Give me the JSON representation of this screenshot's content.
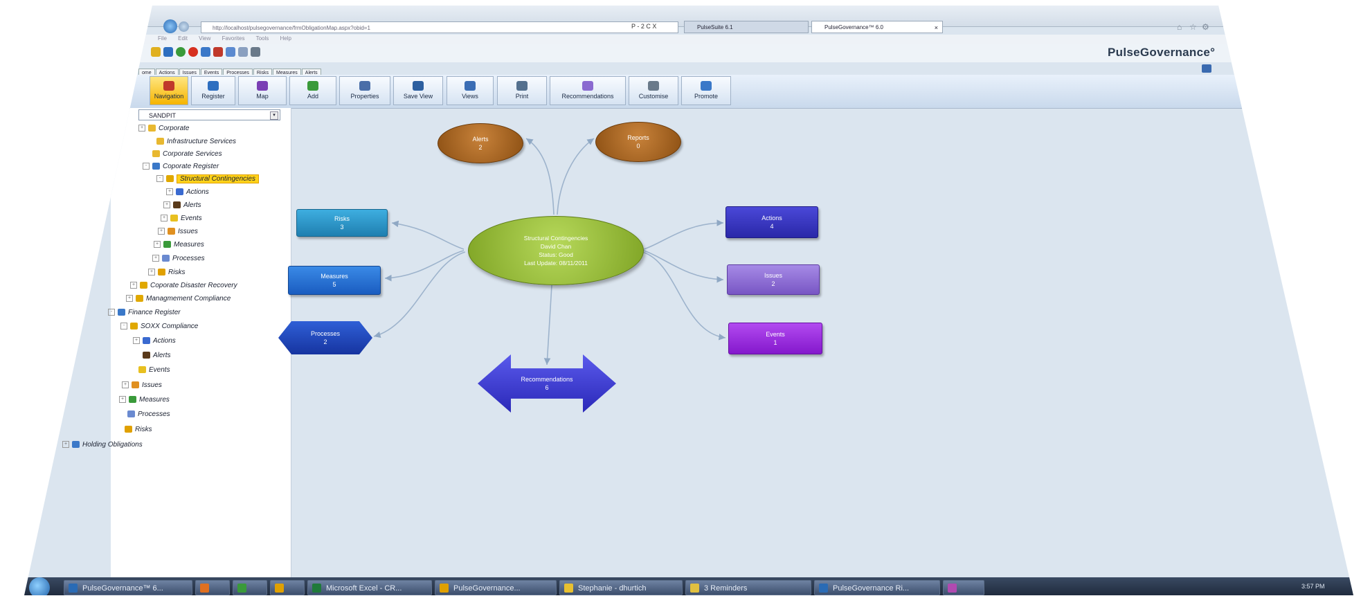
{
  "browser": {
    "address": "http://localhost/pulsegovernance/frmObligationMap.aspx?obid=1",
    "search_hint": "P - 2 C X",
    "tabs": [
      "PulseSuite 6.1",
      "PulseGovernance™ 6.0"
    ],
    "menu": [
      "File",
      "Edit",
      "View",
      "Favorites",
      "Tools",
      "Help"
    ]
  },
  "app": {
    "brand": "PulseGovernance°",
    "nav_tabs": [
      "ome",
      "Actions",
      "Issues",
      "Events",
      "Processes",
      "Risks",
      "Measures",
      "Alerts"
    ],
    "ribbon": [
      {
        "label": "Navigation",
        "icon": "navigation-icon",
        "color": "#c0392b"
      },
      {
        "label": "Register",
        "icon": "register-icon",
        "color": "#2e6fc0"
      },
      {
        "label": "Map",
        "icon": "map-icon",
        "color": "#7a3fb4"
      },
      {
        "label": "Add",
        "icon": "add-icon",
        "color": "#3a9a3a"
      },
      {
        "label": "Properties",
        "icon": "properties-icon",
        "color": "#4a6ea8"
      },
      {
        "label": "Save View",
        "icon": "save-view-icon",
        "color": "#2c5fa0"
      },
      {
        "label": "Views",
        "icon": "views-icon",
        "color": "#3b6db4"
      },
      {
        "label": "Print",
        "icon": "print-icon",
        "color": "#54708e"
      },
      {
        "label": "Recommendations",
        "icon": "recommendations-icon",
        "color": "#8a6ad0"
      },
      {
        "label": "Customise",
        "icon": "customise-icon",
        "color": "#6a7a8a"
      },
      {
        "label": "Promote",
        "icon": "promote-icon",
        "color": "#3a78c8"
      }
    ]
  },
  "tree": {
    "combo": "SANDPIT",
    "items": [
      {
        "label": "Corporate",
        "icon": "folder-icon"
      },
      {
        "label": "Infrastructure Services",
        "icon": "folder-icon"
      },
      {
        "label": "Corporate Services",
        "icon": "folder-icon"
      },
      {
        "label": "Coporate Register",
        "icon": "register-icon"
      },
      {
        "label": "Structural Contingencies",
        "icon": "obligation-icon"
      },
      {
        "label": "Actions",
        "icon": "actions-icon"
      },
      {
        "label": "Alerts",
        "icon": "alerts-icon"
      },
      {
        "label": "Events",
        "icon": "events-icon"
      },
      {
        "label": "Issues",
        "icon": "issues-icon"
      },
      {
        "label": "Measures",
        "icon": "measures-icon"
      },
      {
        "label": "Processes",
        "icon": "processes-icon"
      },
      {
        "label": "Risks",
        "icon": "risks-icon"
      },
      {
        "label": "Coporate Disaster Recovery",
        "icon": "obligation-icon"
      },
      {
        "label": "Managmement Compliance",
        "icon": "obligation-icon"
      },
      {
        "label": "Finance Register",
        "icon": "register-icon"
      },
      {
        "label": "SOXX Compliance",
        "icon": "obligation-icon"
      },
      {
        "label": "Actions",
        "icon": "actions-icon"
      },
      {
        "label": "Alerts",
        "icon": "alerts-icon"
      },
      {
        "label": "Events",
        "icon": "events-icon"
      },
      {
        "label": "Issues",
        "icon": "issues-icon"
      },
      {
        "label": "Measures",
        "icon": "measures-icon"
      },
      {
        "label": "Processes",
        "icon": "processes-icon"
      },
      {
        "label": "Risks",
        "icon": "risks-icon"
      },
      {
        "label": "Holding Obligations",
        "icon": "register-icon"
      }
    ]
  },
  "map": {
    "center": {
      "line1": "Structural Contingencies",
      "line2": "David Chan",
      "line3": "Status: Good",
      "line4": "Last Update: 08/11/2011"
    },
    "nodes": {
      "alerts": {
        "label": "Alerts",
        "count": "2"
      },
      "reports": {
        "label": "Reports",
        "count": "0"
      },
      "risks": {
        "label": "Risks",
        "count": "3"
      },
      "measures": {
        "label": "Measures",
        "count": "5"
      },
      "processes": {
        "label": "Processes",
        "count": "2"
      },
      "recommendations": {
        "label": "Recommendations",
        "count": "6"
      },
      "actions": {
        "label": "Actions",
        "count": "4"
      },
      "issues": {
        "label": "Issues",
        "count": "2"
      },
      "events": {
        "label": "Events",
        "count": "1"
      }
    }
  },
  "taskbar": {
    "items": [
      "PulseGovernance™ 6...",
      "",
      "",
      "",
      "Microsoft Excel - CR...",
      "PulseGovernance...",
      "Stephanie - dhurtich",
      "3 Reminders",
      "PulseGovernance Ri...",
      ""
    ],
    "clock": "3:57 PM"
  },
  "colors": {
    "center": "#9bc53d",
    "alerts": "#a0621c",
    "reports": "#a0621c",
    "risks": "#2a96c8",
    "measures": "#1f6fd0",
    "processes": "#1c46b8",
    "recommendations": "#3d3ad2",
    "actions": "#3936c2",
    "issues": "#8c6ad2",
    "events": "#9a28e0"
  }
}
